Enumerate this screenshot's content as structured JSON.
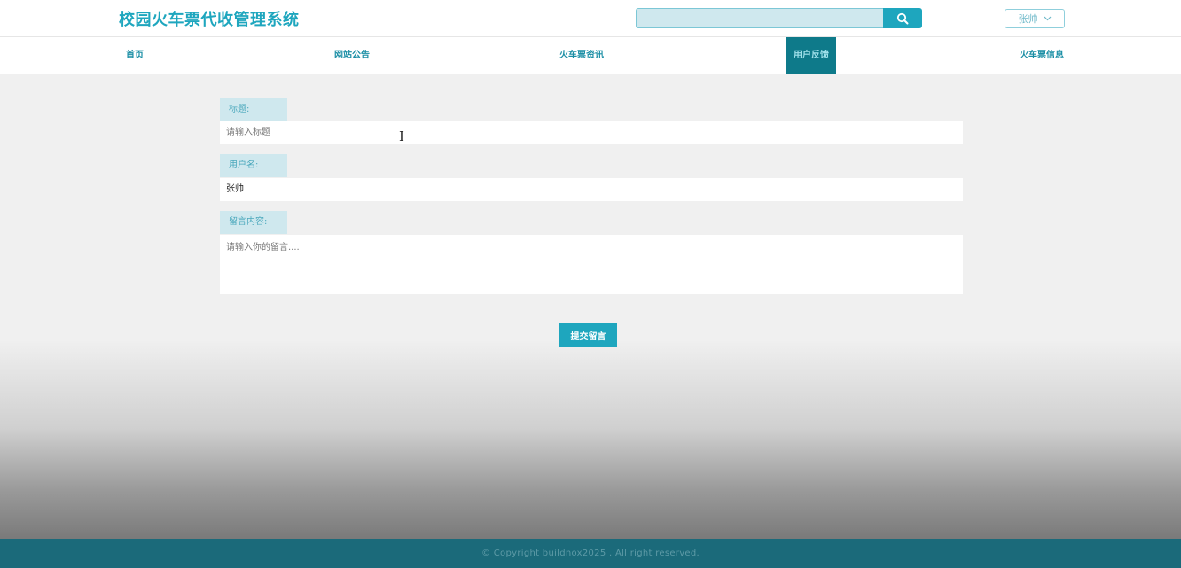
{
  "header": {
    "logo": "校园火车票代收管理系统",
    "search_placeholder": "",
    "user_name": "张帅"
  },
  "nav": {
    "items": [
      {
        "label": "首页"
      },
      {
        "label": "网站公告"
      },
      {
        "label": "火车票资讯"
      },
      {
        "label": "用户反馈"
      },
      {
        "label": "火车票信息"
      }
    ],
    "active": "用户反馈"
  },
  "form": {
    "title_label": "标题:",
    "title_placeholder": "请输入标题",
    "title_value": "",
    "username_label": "用户名:",
    "username_value": "张帅",
    "content_label": "留言内容:",
    "content_placeholder": "请输入你的留言....",
    "submit_label": "提交留言"
  },
  "footer": {
    "copyright": "© Copyright buildnox2025 . All right reserved."
  },
  "colors": {
    "accent": "#1ea6be",
    "nav_active_bg": "#0e7a8a",
    "label_bg": "#cfe8ee",
    "footer_bg": "#1b6a7a"
  },
  "icons": {
    "search": "search-icon",
    "user_dropdown": "chevron-down-icon",
    "cursor": "text-cursor-icon"
  }
}
